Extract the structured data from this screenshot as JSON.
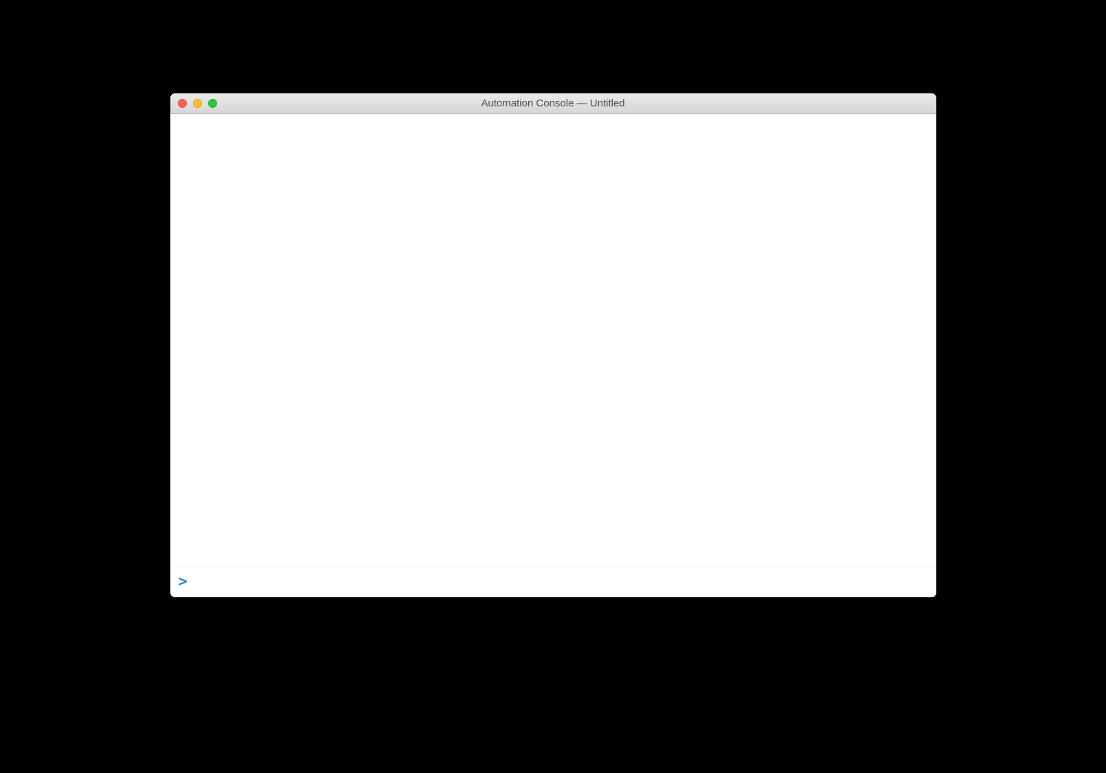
{
  "window": {
    "title": "Automation Console — Untitled"
  },
  "console": {
    "prompt_symbol": ">",
    "input_value": "",
    "output": ""
  },
  "colors": {
    "close": "#ff5f57",
    "minimize": "#febc2e",
    "zoom": "#28c840",
    "prompt": "#3b7dd8"
  }
}
